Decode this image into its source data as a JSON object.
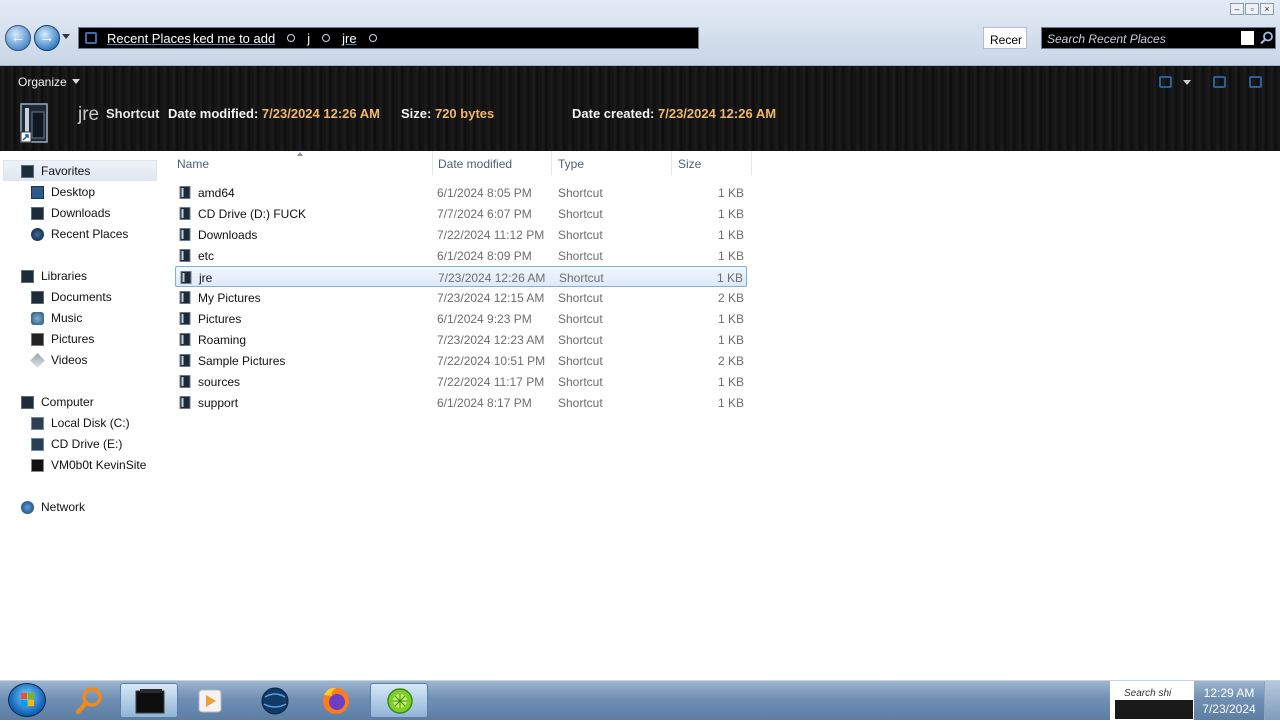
{
  "address": {
    "crumbs": [
      "Recent Places",
      "ked me to add",
      "j",
      "jre"
    ],
    "refresh_text": "Recer",
    "search_placeholder": "Search Recent Places"
  },
  "toolbar": {
    "organize_label": "Organize"
  },
  "details": {
    "name": "jre",
    "type": "Shortcut",
    "date_modified_label": "Date modified:",
    "date_modified": "7/23/2024 12:26 AM",
    "size_label": "Size:",
    "size": "720 bytes",
    "date_created_label": "Date created:",
    "date_created": "7/23/2024 12:26 AM"
  },
  "nav": {
    "favorites": {
      "label": "Favorites",
      "items": [
        "Desktop",
        "Downloads",
        "Recent Places"
      ]
    },
    "libraries": {
      "label": "Libraries",
      "items": [
        "Documents",
        "Music",
        "Pictures",
        "Videos"
      ]
    },
    "computer": {
      "label": "Computer",
      "items": [
        "Local Disk (C:)",
        "CD Drive (E:)",
        "VM0b0t KevinSite"
      ]
    },
    "network": {
      "label": "Network"
    }
  },
  "columns": {
    "name": "Name",
    "date": "Date modified",
    "type": "Type",
    "size": "Size"
  },
  "files": [
    {
      "name": "amd64",
      "date": "6/1/2024 8:05 PM",
      "type": "Shortcut",
      "size": "1 KB",
      "selected": false
    },
    {
      "name": "CD Drive (D:) FUCK",
      "date": "7/7/2024 6:07 PM",
      "type": "Shortcut",
      "size": "1 KB",
      "selected": false
    },
    {
      "name": "Downloads",
      "date": "7/22/2024 11:12 PM",
      "type": "Shortcut",
      "size": "1 KB",
      "selected": false
    },
    {
      "name": "etc",
      "date": "6/1/2024 8:09 PM",
      "type": "Shortcut",
      "size": "1 KB",
      "selected": false
    },
    {
      "name": "jre",
      "date": "7/23/2024 12:26 AM",
      "type": "Shortcut",
      "size": "1 KB",
      "selected": true
    },
    {
      "name": "My Pictures",
      "date": "7/23/2024 12:15 AM",
      "type": "Shortcut",
      "size": "2 KB",
      "selected": false
    },
    {
      "name": "Pictures",
      "date": "6/1/2024 9:23 PM",
      "type": "Shortcut",
      "size": "1 KB",
      "selected": false
    },
    {
      "name": "Roaming",
      "date": "7/23/2024 12:23 AM",
      "type": "Shortcut",
      "size": "1 KB",
      "selected": false
    },
    {
      "name": "Sample Pictures",
      "date": "7/22/2024 10:51 PM",
      "type": "Shortcut",
      "size": "2 KB",
      "selected": false
    },
    {
      "name": "sources",
      "date": "7/22/2024 11:17 PM",
      "type": "Shortcut",
      "size": "1 KB",
      "selected": false
    },
    {
      "name": "support",
      "date": "6/1/2024 8:17 PM",
      "type": "Shortcut",
      "size": "1 KB",
      "selected": false
    }
  ],
  "taskbar": {
    "tray_search": "Search shi",
    "time": "12:29 AM",
    "date": "7/23/2024"
  },
  "colors": {
    "detail_value": "#f0b86a",
    "selection_border": "#84acdd",
    "taskbar": "#6f8fb3"
  }
}
